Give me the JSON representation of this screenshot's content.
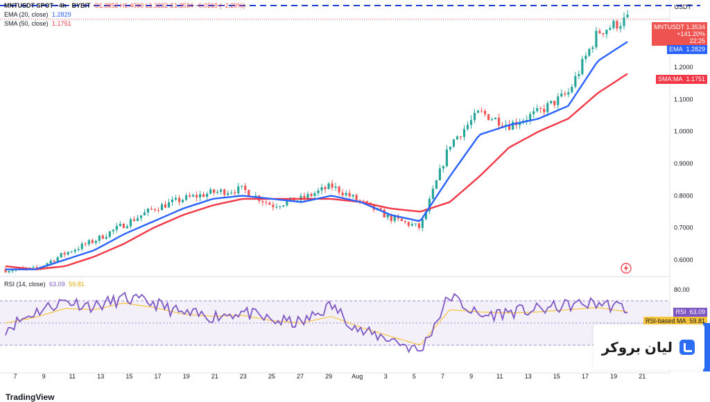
{
  "header": {
    "symbol": "MNTUSDT SPOT · 4h · BYBIT",
    "ohlc": "O1.3852 H1.4000 L1.3232 C1.3534 −0.0318 (−2.29%)",
    "ema_label": "EMA (20, close)",
    "ema_value": "1.2829",
    "sma_label": "SMA (50, close)",
    "sma_value": "1.1751",
    "rsi_label": "RSI (14, close)",
    "rsi_value": "63.09",
    "rsi_ma_value": "59.81"
  },
  "price_scale": {
    "currency": "USDT",
    "ticks": [
      "1.2000",
      "1.1000",
      "1.0000",
      "0.9000",
      "0.8000",
      "0.7000",
      "0.6000"
    ],
    "tick_values": [
      1.2,
      1.1,
      1.0,
      0.9,
      0.8,
      0.7,
      0.6
    ]
  },
  "rsi_scale": {
    "ticks": [
      "80.00"
    ]
  },
  "tags": {
    "price_symbol": "MNTUSDT",
    "price_value": "1.3534",
    "price_change": "+141.20%",
    "price_timer": "22:25",
    "ema_name": "EMA",
    "ema_value": "1.2829",
    "sma_name": "SMA:MA",
    "sma_value": "1.1751",
    "rsi_name": "RSI",
    "rsi_value": "63.09",
    "rsi_ma_name": "RSI-based MA",
    "rsi_ma_value": "59.81"
  },
  "time_axis": [
    "7",
    "9",
    "11",
    "13",
    "15",
    "17",
    "19",
    "21",
    "23",
    "25",
    "27",
    "29",
    "Aug",
    "3",
    "5",
    "7",
    "9",
    "11",
    "13",
    "15",
    "17",
    "19",
    "21"
  ],
  "brand": {
    "name": "لیان بروکر"
  },
  "footer": {
    "logo": "TradingView"
  },
  "colors": {
    "up": "#26a69a",
    "down": "#ef5350",
    "ema": "#2962ff",
    "sma": "#f23645",
    "rsi": "#7e57c2",
    "rsi_ma": "#f7c53c",
    "brand": "#2a6df4"
  },
  "chart_data": {
    "type": "line",
    "title": "MNTUSDT SPOT · 4h · BYBIT",
    "y_range": [
      0.55,
      1.41
    ],
    "x_categories": [
      "7",
      "9",
      "11",
      "13",
      "15",
      "17",
      "19",
      "21",
      "23",
      "25",
      "27",
      "29",
      "Aug",
      "3",
      "5",
      "7",
      "9",
      "11",
      "13",
      "15",
      "17",
      "19"
    ],
    "series": [
      {
        "name": "Close (approx.)",
        "values": [
          0.57,
          0.57,
          0.62,
          0.66,
          0.71,
          0.76,
          0.79,
          0.81,
          0.82,
          0.77,
          0.79,
          0.83,
          0.78,
          0.73,
          0.7,
          0.96,
          1.06,
          1.02,
          1.06,
          1.12,
          1.31,
          1.35
        ]
      },
      {
        "name": "EMA (20, close)",
        "values": [
          0.57,
          0.57,
          0.6,
          0.63,
          0.68,
          0.72,
          0.76,
          0.79,
          0.8,
          0.79,
          0.78,
          0.8,
          0.78,
          0.74,
          0.72,
          0.86,
          0.99,
          1.02,
          1.04,
          1.08,
          1.22,
          1.28
        ]
      },
      {
        "name": "SMA (50, close)",
        "values": [
          0.58,
          0.57,
          0.58,
          0.61,
          0.65,
          0.7,
          0.74,
          0.77,
          0.79,
          0.79,
          0.79,
          0.79,
          0.78,
          0.76,
          0.75,
          0.78,
          0.86,
          0.95,
          1.0,
          1.04,
          1.12,
          1.18
        ]
      }
    ],
    "rsi": {
      "name": "RSI (14, close)",
      "upper": 70,
      "lower": 30,
      "values": [
        45,
        60,
        70,
        65,
        72,
        68,
        58,
        56,
        60,
        52,
        50,
        66,
        42,
        36,
        24,
        75,
        56,
        60,
        62,
        66,
        68,
        63
      ],
      "ma_values": [
        50,
        55,
        63,
        62,
        68,
        64,
        58,
        56,
        57,
        52,
        50,
        56,
        46,
        38,
        30,
        62,
        60,
        59,
        60,
        62,
        64,
        60
      ]
    }
  }
}
